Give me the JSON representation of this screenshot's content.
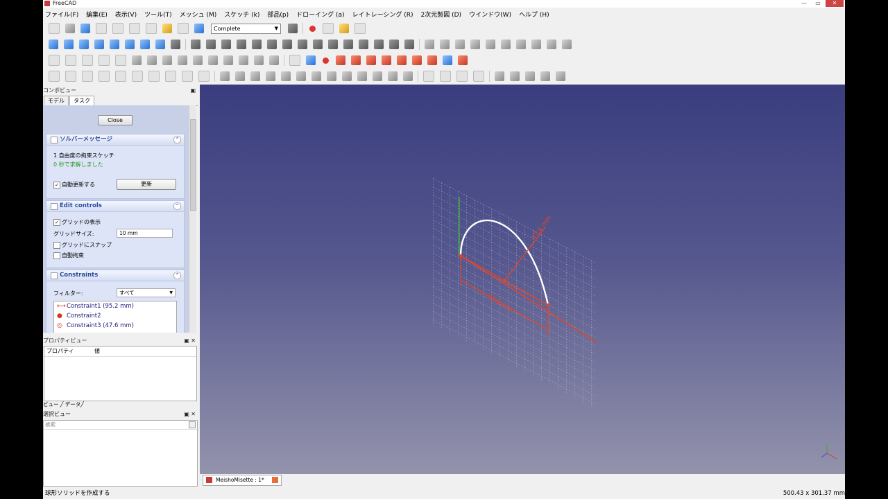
{
  "window": {
    "title": "FreeCAD"
  },
  "menu": [
    "ファイル(F)",
    "編集(E)",
    "表示(V)",
    "ツール(T)",
    "メッシュ (M)",
    "スケッチ (k)",
    "部品(p)",
    "ドローイング (a)",
    "レイトレーシング (R)",
    "2次元製図 (D)",
    "ウインドウ(W)",
    "ヘルプ (H)"
  ],
  "toolbar": {
    "workbench": "Complete"
  },
  "combo_view": {
    "title": "コンボビュー",
    "tabs": [
      "モデル",
      "タスク"
    ],
    "close_label": "Close",
    "solver": {
      "title": "ソルバーメッセージ",
      "dof_text": "1 自由度の拘束スケッチ",
      "time_text": "0 秒で求解しました",
      "auto_update_label": "自動更新する",
      "update_button": "更新"
    },
    "edit_controls": {
      "title": "Edit controls",
      "show_grid_label": "グリッドの表示",
      "grid_size_label": "グリッドサイズ:",
      "grid_size_value": "10 mm",
      "snap_label": "グリッドにスナップ",
      "auto_constraint_label": "自動拘束"
    },
    "constraints": {
      "title": "Constraints",
      "filter_label": "フィルター:",
      "filter_value": "すべて",
      "items": [
        "Constraint1 (95.2 mm)",
        "Constraint2",
        "Constraint3 (47.6 mm)"
      ]
    }
  },
  "property_view": {
    "title": "プロパティビュー",
    "col_property": "プロパティ",
    "col_value": "値",
    "tabs": "ビュー ╱ データ╱"
  },
  "selection_view": {
    "title": "選択ビュー",
    "search_placeholder": "検索"
  },
  "viewport": {
    "dim_label_1": "95.2 mm",
    "dim_label_2": "47.6 mm"
  },
  "document_tab": {
    "label": "MeishoMisette : 1*"
  },
  "status": {
    "message": "球形ソリッドを作成する",
    "coords": "500.43 x 301.37 mm"
  }
}
